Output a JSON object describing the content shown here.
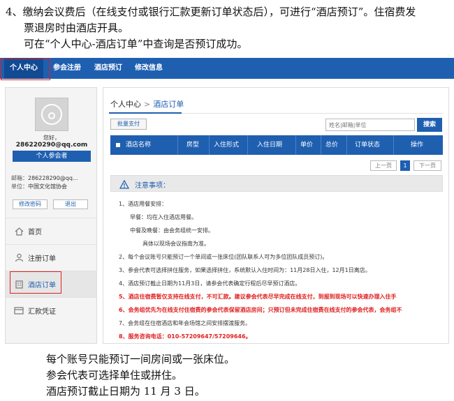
{
  "doc": {
    "top_line1": "4、缴纳会议费后（在线支付或银行汇款更新订单状态后），可进行“酒店预订”。住宿费发",
    "top_line2": "票退房时由酒店开具。",
    "top_line3": "可在“个人中心-酒店订单”中查询是否预订成功。",
    "bottom_line1": "每个账号只能预订一间房间或一张床位。",
    "bottom_line2": "参会代表可选择单住或拼住。",
    "bottom_line3": "酒店预订截止日期为 11 月 3 日。"
  },
  "nav": {
    "items": [
      "个人中心",
      "参会注册",
      "酒店预订",
      "修改信息"
    ]
  },
  "sidebar": {
    "greeting": "您好，",
    "email": "286220290@qq.com",
    "center_btn": "个人参会者",
    "mail_label": "邮箱：",
    "mail_value": "286228290@qq...",
    "unit_label": "单位：",
    "unit_value": "中国文化馆协会",
    "edit_pwd": "修改密码",
    "logout": "退出",
    "menu": [
      "首页",
      "注册订单",
      "酒店订单",
      "汇款凭证"
    ]
  },
  "content": {
    "breadcrumb_root": "个人中心",
    "breadcrumb_sep": ">",
    "breadcrumb_current": "酒店订单",
    "batch_pay": "批量支付",
    "search_placeholder": "姓名|邮箱|单位",
    "search_btn": "搜索",
    "columns": [
      "酒店名称",
      "房型",
      "入住形式",
      "入住日期",
      "单价",
      "总价",
      "订单状态",
      "操作"
    ],
    "pager": {
      "prev": "上一页",
      "page": "1",
      "next": "下一页"
    },
    "notice_title": "注意事项：",
    "notes": [
      "1、酒店用餐安排：",
      "早餐：均在入住酒店用餐。",
      "中餐及晚餐：由会务组统一安排。",
      "具体以现场会议指南为准。",
      "2、每个会议账号只能预订一个单间或一张床位(团队联系人可为多位团队成员预订)。",
      "3、参会代表可选择拼住服务，如果选择拼住，系统默认入住时间为：11月28日入住，12月1日离店。",
      "4、酒店预订截止日期为11月3日，请参会代表确定行程后尽早预订酒店。",
      "5、酒店住宿费暂仅支持在线支付，不可汇款。建议参会代表尽早完成在线支付，到报到现场可以快速办理入住手",
      "6、会务组优先为在线支付住宿费的参会代表保留酒店房间；只预订但未完成住宿费在线支付的参会代表，会务组不",
      "7、会务组在住宿酒店和年会场馆之间安排摆渡服务。",
      "8、服务咨询电话：010-57209647/57209646。"
    ]
  },
  "colors": {
    "primary": "#1f5fb0",
    "highlight_box": "#e02020",
    "warning_text": "#e02020"
  }
}
